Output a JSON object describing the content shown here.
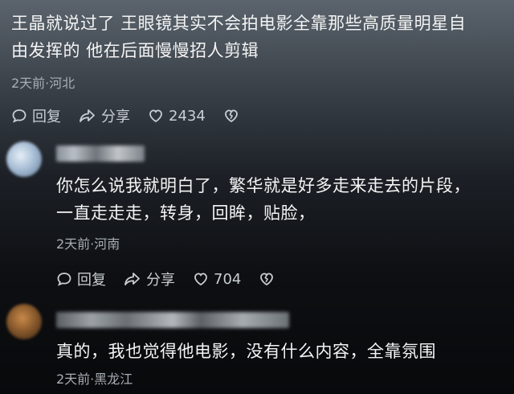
{
  "comments": [
    {
      "text_line1": "王晶就说过了 王眼镜其实不会拍电影全靠那些高质量明星自",
      "text_line2": "由发挥的 他在后面慢慢招人剪辑",
      "meta": "2天前·河北",
      "reply_label": "回复",
      "share_label": "分享",
      "like_count": "2434"
    },
    {
      "text_line1": "你怎么说我就明白了，繁华就是好多走来走去的片段，",
      "text_line2": "一直走走走，转身，回眸，贴脸，",
      "meta": "2天前·河南",
      "reply_label": "回复",
      "share_label": "分享",
      "like_count": "704"
    },
    {
      "text_line1": "真的，我也觉得他电影，没有什么内容，全靠氛围",
      "meta": "2天前·黑龙江"
    }
  ],
  "icons": {
    "reply": "speech-bubble-icon",
    "share": "share-arrow-icon",
    "like": "heart-icon",
    "dislike": "broken-heart-icon"
  }
}
